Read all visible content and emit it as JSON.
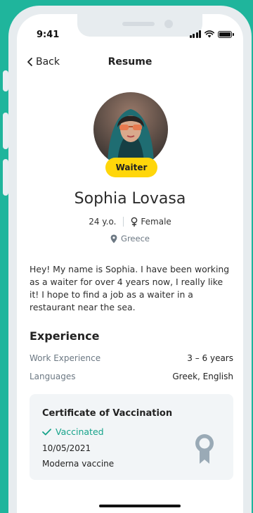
{
  "status_bar": {
    "time": "9:41"
  },
  "nav": {
    "back_label": "Back",
    "title": "Resume"
  },
  "profile": {
    "role": "Waiter",
    "name": "Sophia Lovasa",
    "age": "24 y.o.",
    "gender": "Female",
    "location": "Greece",
    "bio": "Hey! My name is Sophia. I have been working as a waiter for over 4 years now, I really like it! I hope to find a job as a waiter in a restaurant near the sea."
  },
  "experience": {
    "title": "Experience",
    "rows": [
      {
        "label": "Work Experience",
        "value": "3 – 6 years"
      },
      {
        "label": "Languages",
        "value": "Greek, English"
      }
    ]
  },
  "certificate": {
    "title": "Certificate of Vaccination",
    "status": "Vaccinated",
    "date": "10/05/2021",
    "vaccine": "Moderna vaccine"
  },
  "colors": {
    "background": "#1fb59c",
    "badge": "#ffd60a",
    "accent": "#16a38a"
  },
  "icons": [
    "back-chevron-icon",
    "female-icon",
    "location-pin-icon",
    "check-icon",
    "award-icon",
    "signal-icon",
    "wifi-icon",
    "battery-icon"
  ]
}
